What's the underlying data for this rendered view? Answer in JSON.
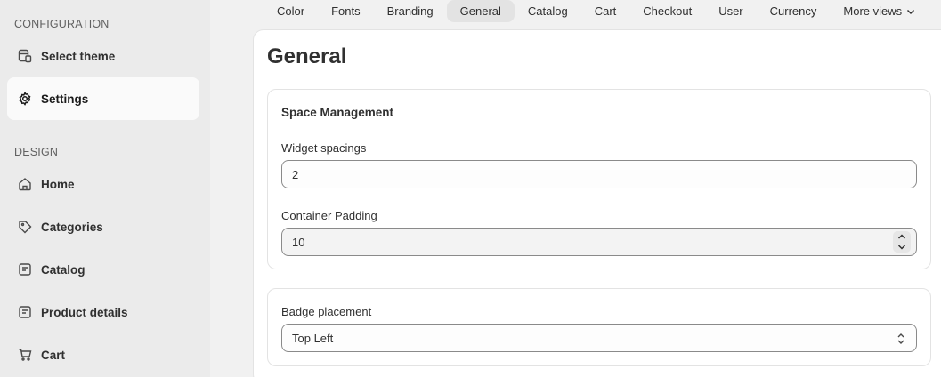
{
  "sidebar": {
    "configuration_heading": "CONFIGURATION",
    "design_heading": "DESIGN",
    "items": [
      {
        "label": "Select theme",
        "icon": "theme-icon"
      },
      {
        "label": "Settings",
        "icon": "gear-icon",
        "active": true
      },
      {
        "label": "Home",
        "icon": "home-icon"
      },
      {
        "label": "Categories",
        "icon": "tag-icon"
      },
      {
        "label": "Catalog",
        "icon": "catalog-icon"
      },
      {
        "label": "Product details",
        "icon": "product-details-icon"
      },
      {
        "label": "Cart",
        "icon": "cart-icon"
      }
    ]
  },
  "tabs": [
    {
      "label": "Color"
    },
    {
      "label": "Fonts"
    },
    {
      "label": "Branding"
    },
    {
      "label": "General",
      "active": true
    },
    {
      "label": "Catalog"
    },
    {
      "label": "Cart"
    },
    {
      "label": "Checkout"
    },
    {
      "label": "User"
    },
    {
      "label": "Currency"
    },
    {
      "label": "More views"
    }
  ],
  "main": {
    "title": "General",
    "space_management": {
      "heading": "Space Management",
      "widget_spacings_label": "Widget spacings",
      "widget_spacings_value": "2",
      "container_padding_label": "Container Padding",
      "container_padding_value": "10"
    },
    "badge": {
      "label": "Badge placement",
      "value": "Top Left"
    }
  },
  "colors": {
    "sidebar_bg": "#ebebeb",
    "page_bg": "#f1f1f1",
    "active_tab_bg": "#e3e3e3",
    "text": "#303030"
  }
}
